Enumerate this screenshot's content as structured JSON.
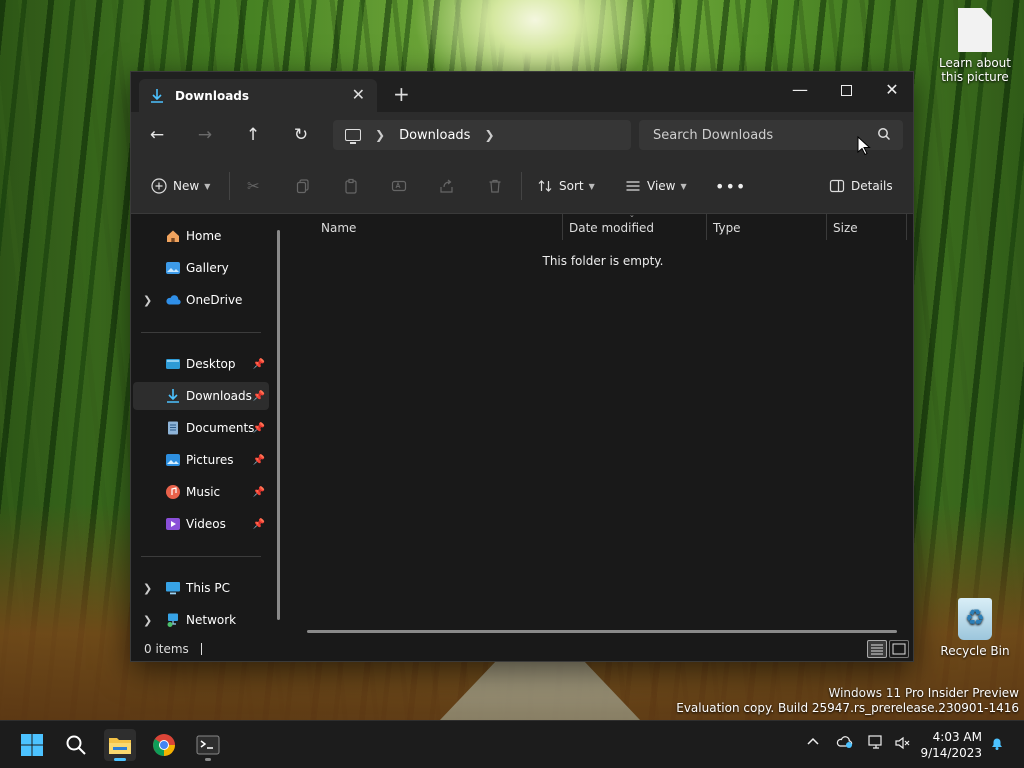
{
  "desktop": {
    "icons": [
      {
        "label": "Learn about this picture"
      },
      {
        "label": "Recycle Bin"
      }
    ],
    "watermark": {
      "line1": "Windows 11 Pro Insider Preview",
      "line2": "Evaluation copy. Build 25947.rs_prerelease.230901-1416"
    }
  },
  "window": {
    "tab_title": "Downloads",
    "address": {
      "crumb": "Downloads"
    },
    "search": {
      "placeholder": "Search Downloads"
    },
    "toolbar": {
      "new_label": "New",
      "sort_label": "Sort",
      "view_label": "View",
      "details_label": "Details"
    },
    "sidebar": {
      "items": [
        {
          "label": "Home"
        },
        {
          "label": "Gallery"
        },
        {
          "label": "OneDrive"
        },
        {
          "label": "Desktop"
        },
        {
          "label": "Downloads"
        },
        {
          "label": "Documents"
        },
        {
          "label": "Pictures"
        },
        {
          "label": "Music"
        },
        {
          "label": "Videos"
        },
        {
          "label": "This PC"
        },
        {
          "label": "Network"
        }
      ]
    },
    "columns": [
      "Name",
      "Date modified",
      "Type",
      "Size"
    ],
    "empty_message": "This folder is empty.",
    "status": {
      "item_count": "0 items"
    }
  },
  "taskbar": {
    "clock": {
      "time": "4:03 AM",
      "date": "9/14/2023"
    }
  },
  "colors": {
    "accent": "#4cc2ff",
    "window_bg": "#191919",
    "chrome_bg": "#2c2c2c"
  }
}
